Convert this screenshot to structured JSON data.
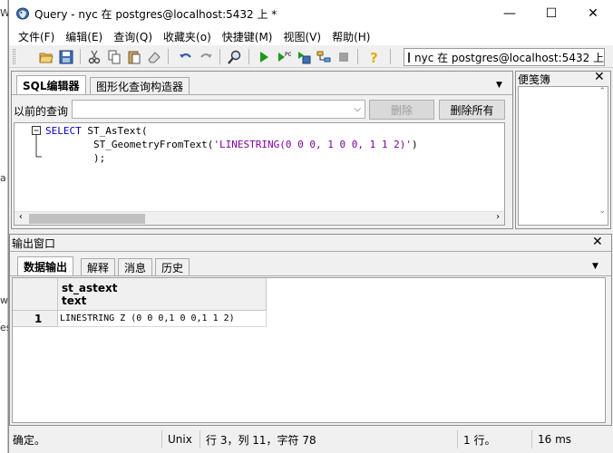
{
  "window": {
    "title": "Query - nyc 在  postgres@localhost:5432 上 *",
    "min_glyph": "—",
    "max_glyph": "☐",
    "close_glyph": "✕"
  },
  "menu": [
    "文件(F)",
    "编辑(E)",
    "查询(Q)",
    "收藏夹(o)",
    "快捷键(M)",
    "视图(V)",
    "帮助(H)"
  ],
  "connection": {
    "label": "nyc 在  postgres@localhost:5432 上"
  },
  "editor_pane": {
    "tabs": [
      "SQL编辑器",
      "图形化查询构造器"
    ],
    "history_label": "以前的查询",
    "delete_button": "删除",
    "delete_all_button": "删除所有",
    "code_lines": [
      {
        "parts": [
          {
            "t": "SELECT",
            "c": "kw"
          },
          {
            "t": " ST_AsText(",
            "c": ""
          }
        ]
      },
      {
        "parts": [
          {
            "t": "        ST_GeometryFromText(",
            "c": ""
          },
          {
            "t": "'LINESTRING(0 0 0, 1 0 0, 1 1 2)'",
            "c": "str"
          },
          {
            "t": ")",
            "c": ""
          }
        ]
      },
      {
        "parts": [
          {
            "t": "        );",
            "c": ""
          }
        ]
      }
    ]
  },
  "scratch_pane": {
    "title": "便笺簿"
  },
  "output_pane": {
    "title": "输出窗口",
    "tabs": [
      "数据输出",
      "解释",
      "消息",
      "历史"
    ],
    "columns": [
      {
        "name": "st_astext",
        "type": "text"
      }
    ],
    "rows": [
      {
        "num": "1",
        "values": [
          "LINESTRING Z (0 0 0,1 0 0,1 1 2)"
        ]
      }
    ]
  },
  "status": {
    "state": "确定。",
    "encoding": "Unix",
    "position": "行 3，列 11，字符 78",
    "rows": "1 行。",
    "time": "16 ms"
  },
  "colors": {
    "keyword": "#0000c0",
    "string": "#8000a0",
    "play": "#1a9a1a"
  }
}
